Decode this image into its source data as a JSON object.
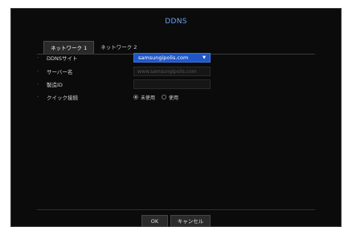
{
  "window": {
    "title": "DDNS"
  },
  "tabs": [
    {
      "label": "ネットワーク 1",
      "active": true
    },
    {
      "label": "ネットワーク 2",
      "active": false
    }
  ],
  "form": {
    "ddns_site": {
      "label": "DDNSサイト",
      "value": "samsungipolis.com"
    },
    "server_name": {
      "label": "サーバー名",
      "placeholder": "www.samsungipolis.com"
    },
    "product_id": {
      "label": "製造ID",
      "value": ""
    },
    "quick_connect": {
      "label": "クイック接続",
      "options": [
        "未使用",
        "使用"
      ],
      "selected": "未使用"
    }
  },
  "buttons": {
    "ok": "OK",
    "cancel": "キャンセル"
  },
  "colors": {
    "accent": "#1f57c8",
    "title": "#6aa3e8",
    "background": "#0b0b0b"
  }
}
